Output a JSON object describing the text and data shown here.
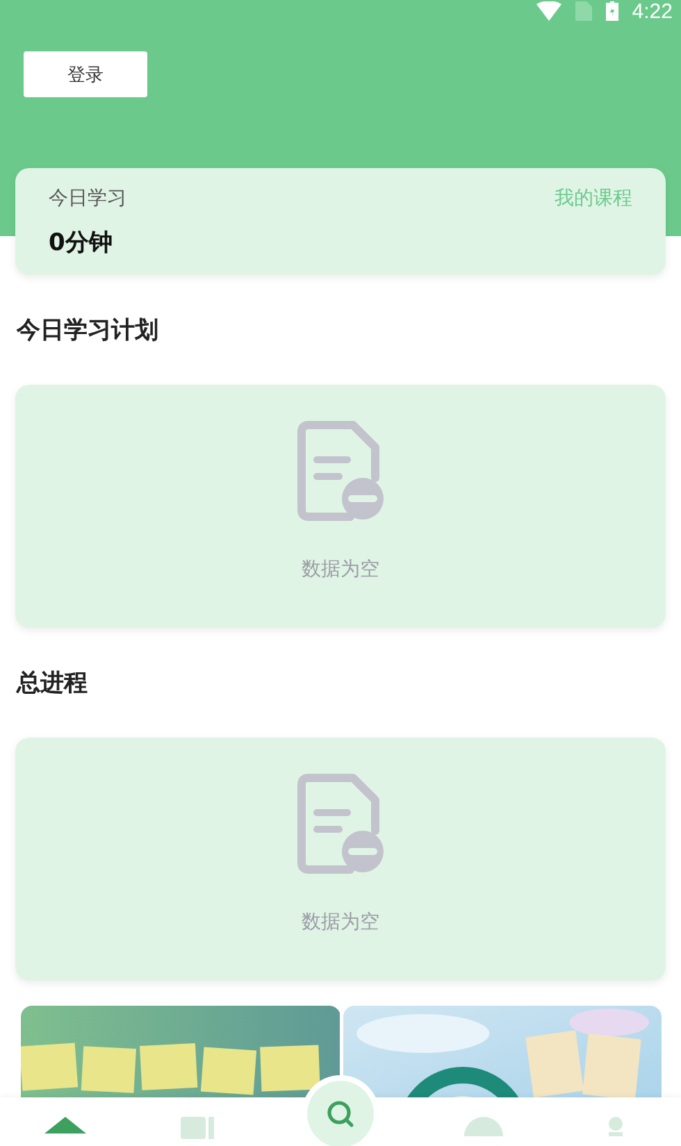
{
  "status_bar": {
    "time": "4:22"
  },
  "header": {
    "login_button": "登录"
  },
  "today_card": {
    "title": "今日学习",
    "link": "我的课程",
    "value": "0分钟"
  },
  "sections": [
    {
      "title": "今日学习计划",
      "empty_text": "数据为空"
    },
    {
      "title": "总进程",
      "empty_text": "数据为空"
    }
  ],
  "bottom_nav": [
    {
      "kind": "home",
      "selected": true
    },
    {
      "kind": "book",
      "selected": false
    },
    {
      "kind": "search",
      "selected": false
    },
    {
      "kind": "chat",
      "selected": false
    },
    {
      "kind": "person",
      "selected": false
    }
  ]
}
